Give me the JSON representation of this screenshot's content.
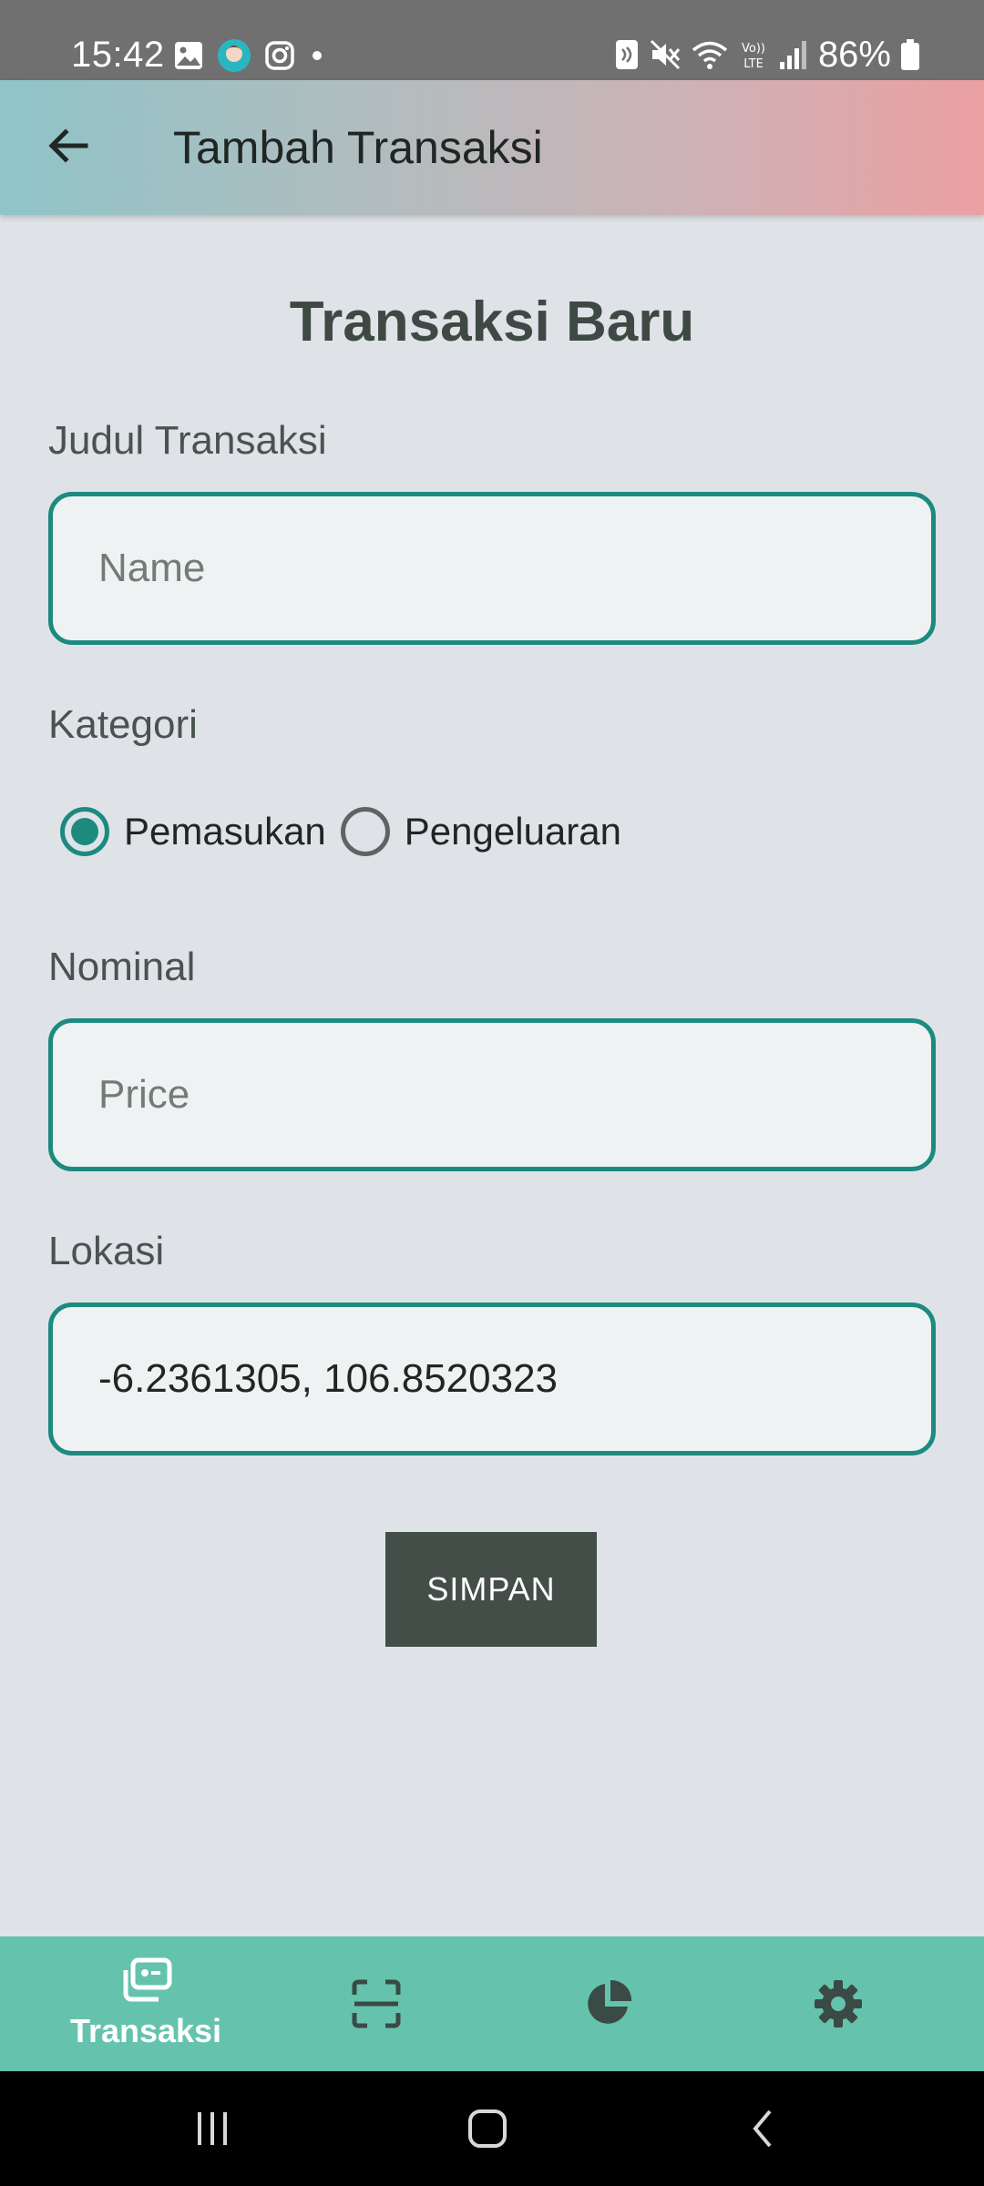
{
  "status_bar": {
    "time": "15:42",
    "battery": "86%",
    "left_icons": [
      "gallery-icon",
      "avatar-app-icon",
      "instagram-icon",
      "dot-icon"
    ],
    "right_icons": [
      "nfc-icon",
      "mute-icon",
      "wifi-icon",
      "volte-icon",
      "signal-icon",
      "battery-icon"
    ]
  },
  "app_bar": {
    "back_icon": "arrow-left-icon",
    "title": "Tambah Transaksi"
  },
  "form": {
    "heading": "Transaksi Baru",
    "title_label": "Judul Transaksi",
    "title_placeholder": "Name",
    "title_value": "",
    "category_label": "Kategori",
    "category_options": [
      {
        "label": "Pemasukan",
        "selected": true
      },
      {
        "label": "Pengeluaran",
        "selected": false
      }
    ],
    "nominal_label": "Nominal",
    "nominal_placeholder": "Price",
    "nominal_value": "",
    "location_label": "Lokasi",
    "location_value": "-6.2361305, 106.8520323",
    "save_label": "SIMPAN"
  },
  "bottom_nav": {
    "items": [
      {
        "label": "Transaksi",
        "icon": "transactions-icon",
        "active": true
      },
      {
        "label": "",
        "icon": "scan-icon",
        "active": false
      },
      {
        "label": "",
        "icon": "pie-chart-icon",
        "active": false
      },
      {
        "label": "",
        "icon": "settings-gear-icon",
        "active": false
      }
    ]
  },
  "system_nav": {
    "icons": [
      "recents-icon",
      "home-icon",
      "back-icon"
    ]
  },
  "colors": {
    "accent": "#1d8a80",
    "button": "#434e48",
    "bottom_nav": "#65c3ad",
    "background": "#dfe3e7"
  }
}
